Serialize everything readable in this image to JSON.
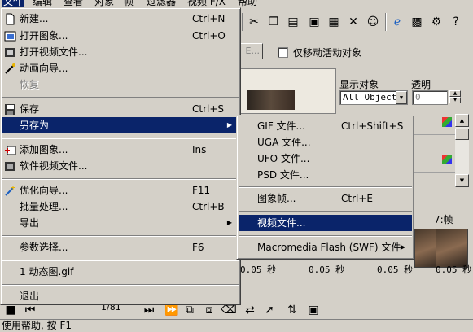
{
  "menubar": {
    "items": [
      "文件",
      "编辑",
      "查看",
      "对象",
      "帧",
      "过滤器",
      "视频 F/X",
      "帮助"
    ]
  },
  "options": {
    "button_label": "E...",
    "checkbox_label": "仅移动活动对象"
  },
  "right_panel": {
    "display_label": "显示对象",
    "display_value": "All Object",
    "opacity_label": "透明",
    "opacity_value": "0"
  },
  "frames": {
    "header_label": "7:帧",
    "times": [
      "0.05 秒",
      "0.05 秒",
      "0.05 秒",
      "0.05 秒"
    ]
  },
  "bottom": {
    "frame_counter": "1/81"
  },
  "status": {
    "text": "使用帮助, 按 F1"
  },
  "file_menu": {
    "new": {
      "label": "新建...",
      "shortcut": "Ctrl+N"
    },
    "open_image": {
      "label": "打开图象...",
      "shortcut": "Ctrl+O"
    },
    "open_video": {
      "label": "打开视频文件..."
    },
    "animation_wizard": {
      "label": "动画向导..."
    },
    "revert": {
      "label": "恢复"
    },
    "save": {
      "label": "保存",
      "shortcut": "Ctrl+S"
    },
    "save_as": {
      "label": "另存为"
    },
    "add_image": {
      "label": "添加图象...",
      "shortcut": "Ins"
    },
    "add_video": {
      "label": "软件视频文件..."
    },
    "optimize_wizard": {
      "label": "优化向导...",
      "shortcut": "F11"
    },
    "batch": {
      "label": "批量处理...",
      "shortcut": "Ctrl+B"
    },
    "export": {
      "label": "导出"
    },
    "preferences": {
      "label": "参数选择...",
      "shortcut": "F6"
    },
    "recent1": {
      "label": "1 动态图.gif"
    },
    "exit": {
      "label": "退出"
    }
  },
  "saveas_menu": {
    "gif": {
      "label": "GIF 文件...",
      "shortcut": "Ctrl+Shift+S"
    },
    "uga": {
      "label": "UGA 文件..."
    },
    "ufo": {
      "label": "UFO 文件..."
    },
    "psd": {
      "label": "PSD 文件..."
    },
    "image_frame": {
      "label": "图象帧...",
      "shortcut": "Ctrl+E"
    },
    "video_file": {
      "label": "视频文件..."
    },
    "flash": {
      "label": "Macromedia Flash (SWF) 文件"
    }
  },
  "colors": {
    "highlight": "#0a246a",
    "face": "#d4d0c8"
  }
}
